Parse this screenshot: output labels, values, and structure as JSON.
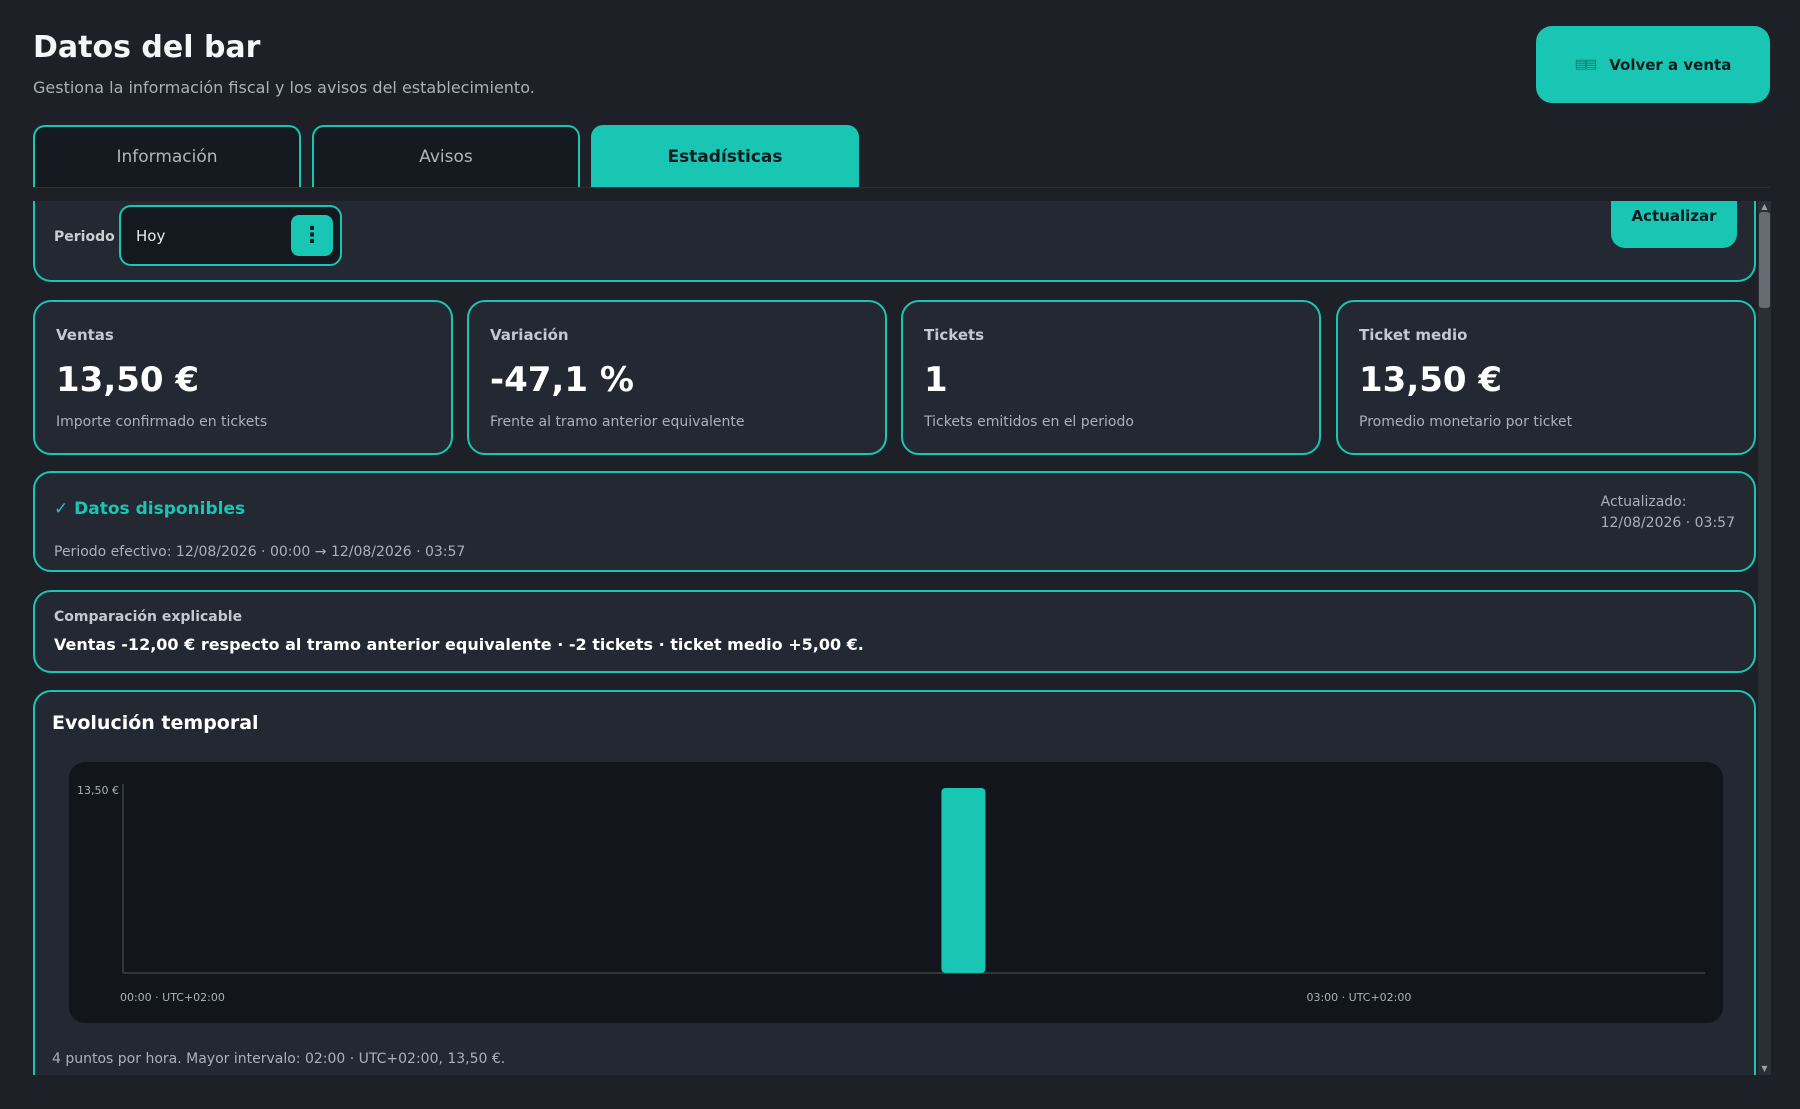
{
  "header": {
    "title": "Datos del bar",
    "subtitle": "Gestiona la información fiscal y los avisos del establecimiento.",
    "back_button": {
      "label": "Volver a venta",
      "icon": "receipt-icon"
    }
  },
  "tabs": [
    {
      "label": "Información",
      "active": false
    },
    {
      "label": "Avisos",
      "active": false
    },
    {
      "label": "Estadísticas",
      "active": true
    }
  ],
  "filters": {
    "period_label": "Periodo",
    "period_value": "Hoy",
    "refresh_label": "Actualizar"
  },
  "kpis": [
    {
      "label": "Ventas",
      "value": "13,50 €",
      "description": "Importe confirmado en tickets"
    },
    {
      "label": "Variación",
      "value": "-47,1 %",
      "description": "Frente al tramo anterior equivalente"
    },
    {
      "label": "Tickets",
      "value": "1",
      "description": "Tickets emitidos en el periodo"
    },
    {
      "label": "Ticket medio",
      "value": "13,50 €",
      "description": "Promedio monetario por ticket"
    }
  ],
  "status": {
    "text": "✓ Datos disponibles",
    "period": "Periodo efectivo: 12/08/2026 · 00:00 → 12/08/2026 · 03:57",
    "updated_label": "Actualizado:",
    "updated_value": "12/08/2026 · 03:57"
  },
  "comparison": {
    "label": "Comparación explicable",
    "text": "Ventas -12,00 € respecto al tramo anterior equivalente · -2 tickets · ticket medio +5,00 €."
  },
  "evolution": {
    "title": "Evolución temporal",
    "footer": "4 puntos por hora. Mayor intervalo: 02:00 · UTC+02:00, 13,50 €."
  },
  "colors": {
    "accent": "#19c6b3",
    "background": "#1d2026",
    "card": "#232832",
    "plot": "#12151c"
  },
  "chart_data": {
    "type": "bar",
    "categories": [
      "00:00",
      "00:15",
      "00:30",
      "00:45",
      "01:00",
      "01:15",
      "01:30",
      "01:45",
      "02:00",
      "02:15",
      "02:30",
      "02:45",
      "03:00",
      "03:15",
      "03:30",
      "03:45"
    ],
    "values": [
      0,
      0,
      0,
      0,
      0,
      0,
      0,
      0,
      13.5,
      0,
      0,
      0,
      0,
      0,
      0,
      0
    ],
    "y_tick_label": "13,50 €",
    "x_tick_labels": [
      {
        "category": "00:00",
        "label": "00:00 · UTC+02:00"
      },
      {
        "category": "03:00",
        "label": "03:00 · UTC+02:00"
      }
    ],
    "ylim": [
      0,
      13.5
    ],
    "title": "",
    "xlabel": "",
    "ylabel": "",
    "grid": false
  }
}
